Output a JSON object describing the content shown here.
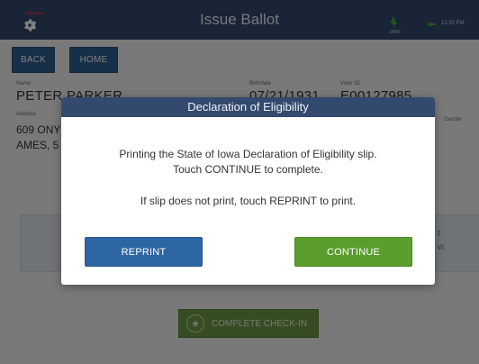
{
  "app": {
    "title": "Issue Ballot",
    "training_label": "TRAINING",
    "battery_percent": "100%",
    "time": "12:20 PM",
    "icons": [
      "gear-icon",
      "battery-icon",
      "wifi-icon"
    ],
    "colors": {
      "topbar": "#33496e",
      "primary_button": "#2e66a3",
      "continue_button": "#5a9e2d"
    }
  },
  "nav": {
    "back_label": "BACK",
    "home_label": "HOME"
  },
  "voter": {
    "name_label": "Name",
    "name": "PETER PARKER",
    "birthdate_label": "Birthdate",
    "birthdate": "07/21/1931",
    "voter_id_label": "Voter ID",
    "voter_id": "E00127985",
    "address_label": "Address",
    "address_line1": "609 ONY",
    "address_line2": "AMES, 5",
    "gender_label": "Gender"
  },
  "background_panel": {
    "text_right1": "t",
    "text_right2": "w."
  },
  "checkin": {
    "label": "COMPLETE CHECK-IN",
    "icon": "star-icon"
  },
  "modal": {
    "title": "Declaration of Eligibility",
    "message_line1": "Printing the State of Iowa Declaration of Eligibility slip.",
    "message_line2": "Touch CONTINUE to complete.",
    "message_line3": "If slip does not print, touch REPRINT to print.",
    "reprint_label": "REPRINT",
    "continue_label": "CONTINUE"
  }
}
